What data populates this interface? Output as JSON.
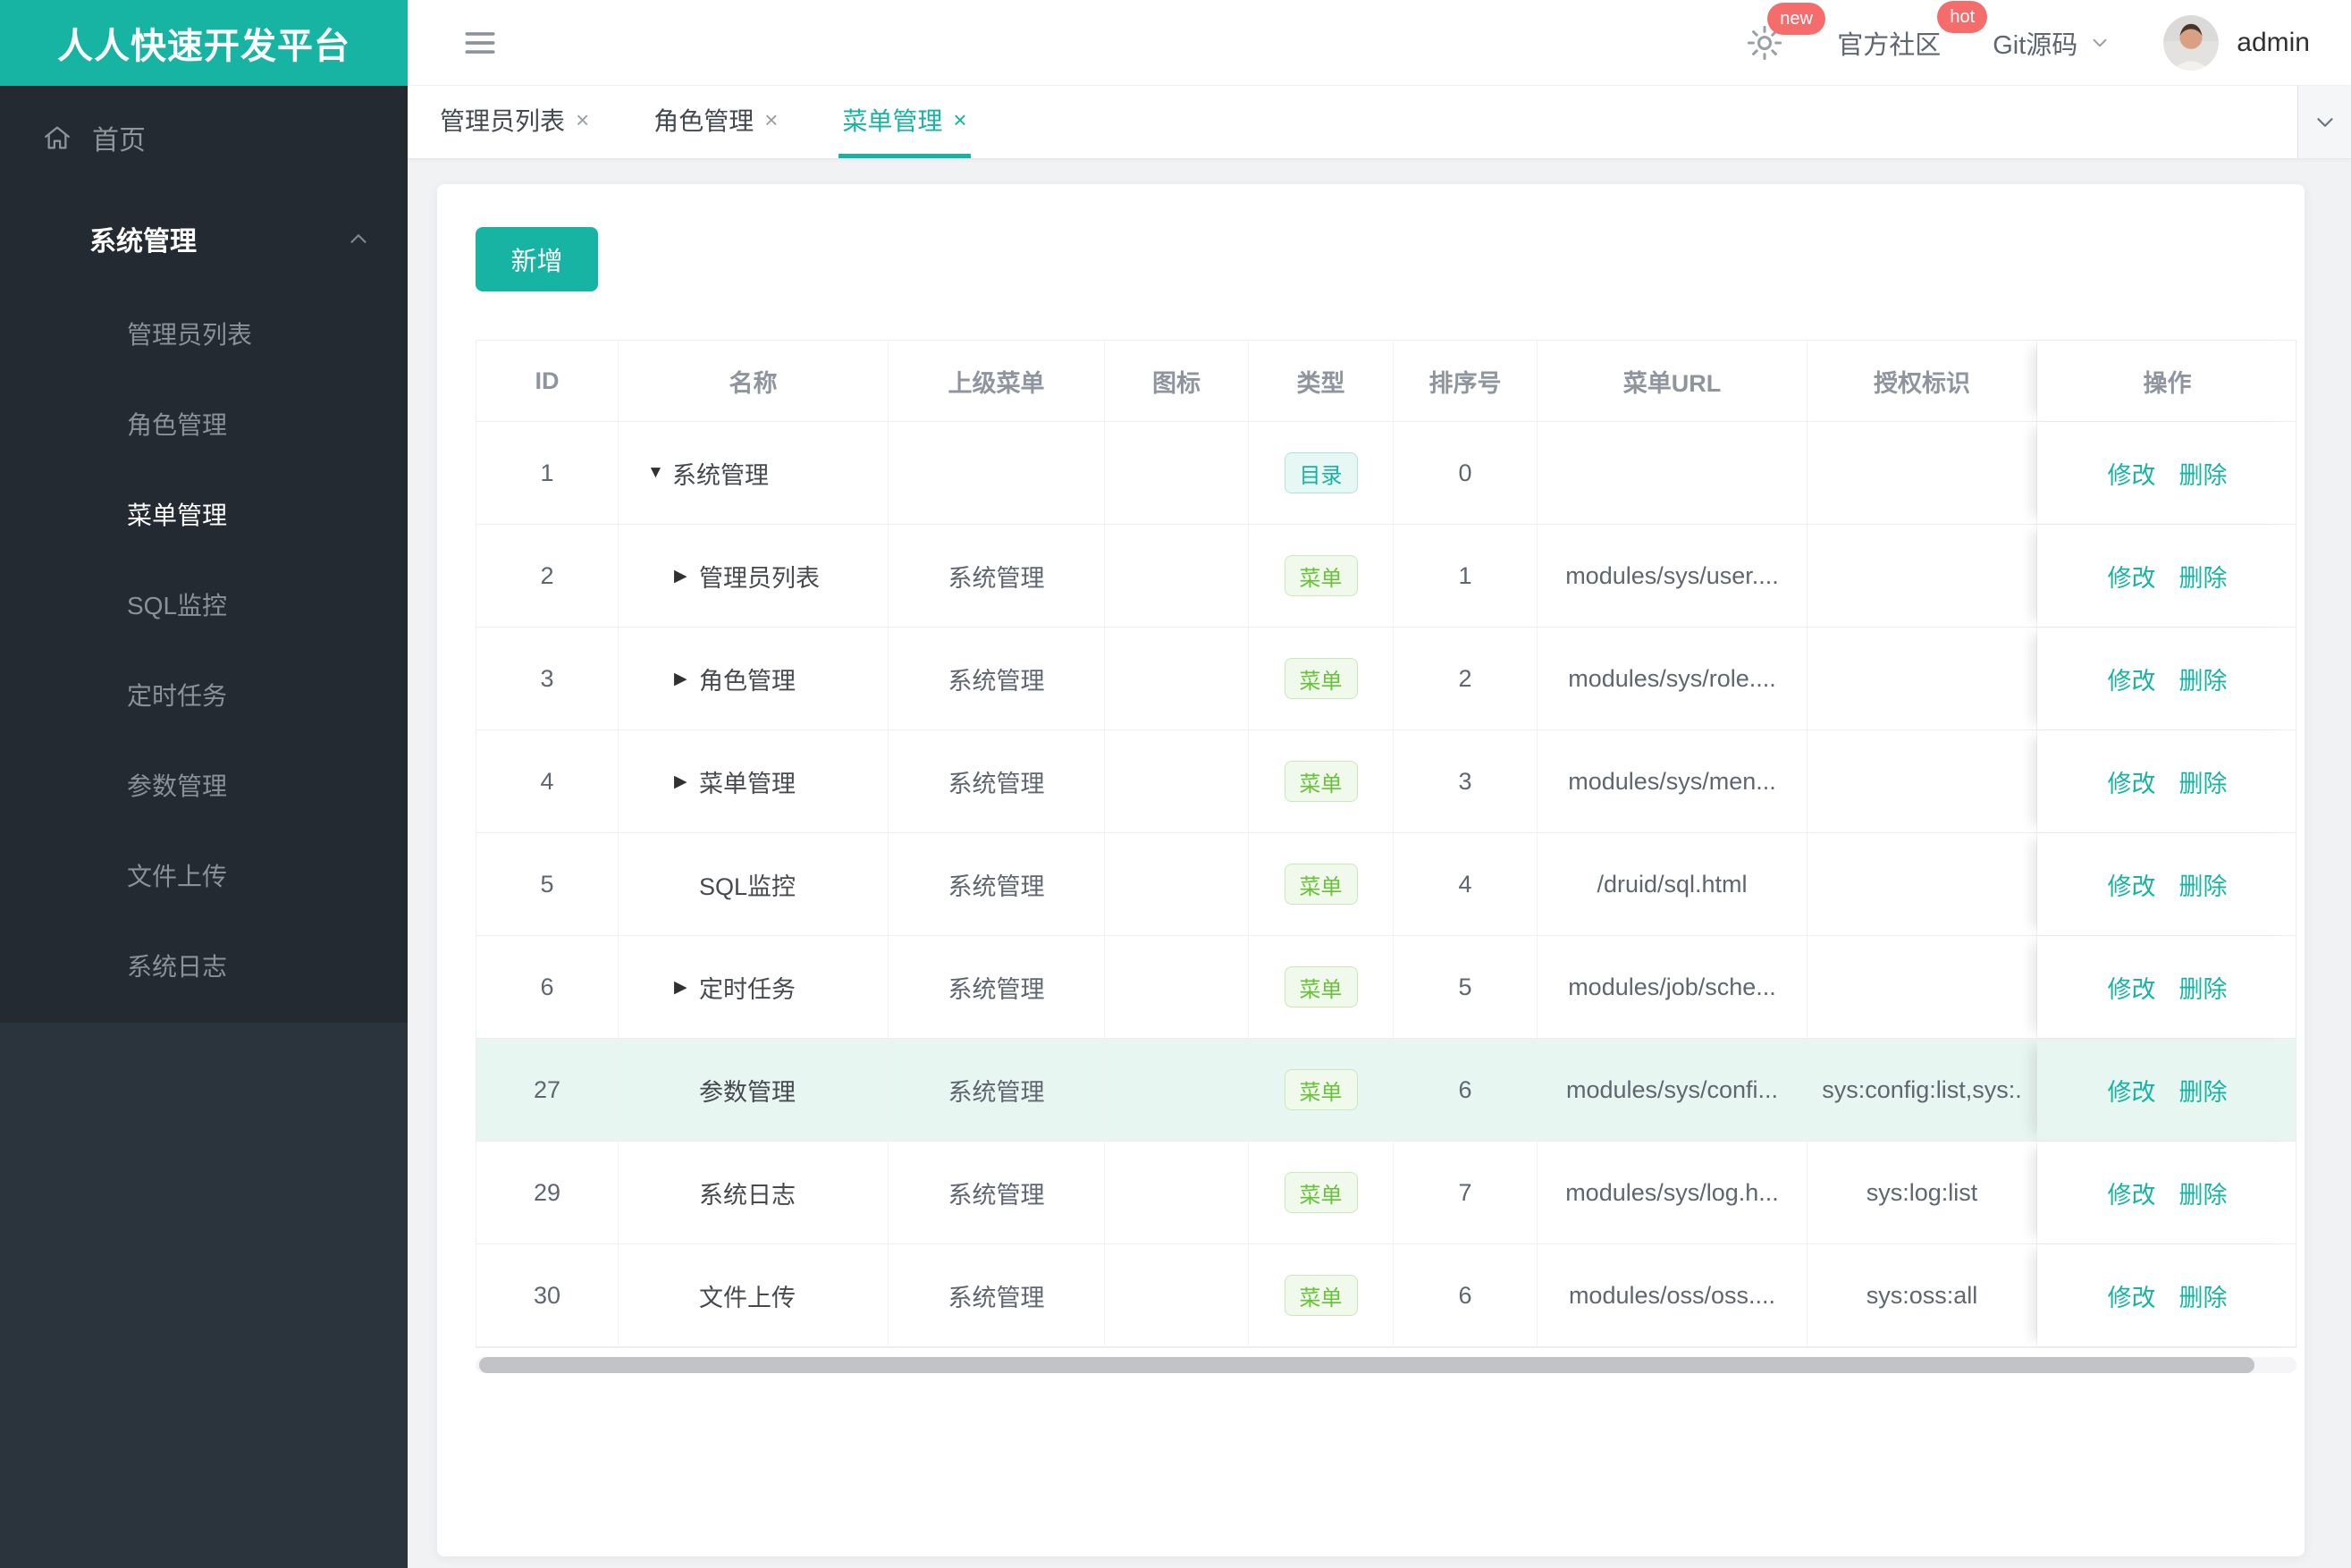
{
  "brand": {
    "title": "人人快速开发平台",
    "accent_color": "#17b3a3",
    "danger_color": "#f56c6c"
  },
  "sidebar": {
    "home": {
      "label": "首页"
    },
    "group": {
      "label": "系统管理"
    },
    "items": [
      {
        "label": "管理员列表",
        "active": false
      },
      {
        "label": "角色管理",
        "active": false
      },
      {
        "label": "菜单管理",
        "active": true
      },
      {
        "label": "SQL监控",
        "active": false
      },
      {
        "label": "定时任务",
        "active": false
      },
      {
        "label": "参数管理",
        "active": false
      },
      {
        "label": "文件上传",
        "active": false
      },
      {
        "label": "系统日志",
        "active": false
      }
    ]
  },
  "topbar": {
    "new_badge": "new",
    "hot_badge": "hot",
    "community_label": "官方社区",
    "git_label": "Git源码",
    "username": "admin"
  },
  "tabs": [
    {
      "label": "管理员列表",
      "close": "×",
      "active": false
    },
    {
      "label": "角色管理",
      "close": "×",
      "active": false
    },
    {
      "label": "菜单管理",
      "close": "×",
      "active": true
    }
  ],
  "toolbar": {
    "add_label": "新增"
  },
  "table": {
    "headers": [
      "ID",
      "名称",
      "上级菜单",
      "图标",
      "类型",
      "排序号",
      "菜单URL",
      "授权标识",
      "操作"
    ],
    "type_labels": {
      "dir": "目录",
      "menu": "菜单"
    },
    "actions": {
      "edit": "修改",
      "delete": "删除"
    },
    "highlight_color": "#e8f6f2",
    "rows": [
      {
        "id": "1",
        "arrow": "down",
        "indent": 1,
        "name": "系统管理",
        "parent": "",
        "icon": "",
        "type": "dir",
        "order": "0",
        "url": "",
        "perms": "",
        "highlight": false
      },
      {
        "id": "2",
        "arrow": "right",
        "indent": 2,
        "name": "管理员列表",
        "parent": "系统管理",
        "icon": "",
        "type": "menu",
        "order": "1",
        "url": "modules/sys/user....",
        "perms": "",
        "highlight": false
      },
      {
        "id": "3",
        "arrow": "right",
        "indent": 2,
        "name": "角色管理",
        "parent": "系统管理",
        "icon": "",
        "type": "menu",
        "order": "2",
        "url": "modules/sys/role....",
        "perms": "",
        "highlight": false
      },
      {
        "id": "4",
        "arrow": "right",
        "indent": 2,
        "name": "菜单管理",
        "parent": "系统管理",
        "icon": "",
        "type": "menu",
        "order": "3",
        "url": "modules/sys/men...",
        "perms": "",
        "highlight": false
      },
      {
        "id": "5",
        "arrow": "none",
        "indent": 2,
        "name": "SQL监控",
        "parent": "系统管理",
        "icon": "",
        "type": "menu",
        "order": "4",
        "url": "/druid/sql.html",
        "perms": "",
        "highlight": false
      },
      {
        "id": "6",
        "arrow": "right",
        "indent": 2,
        "name": "定时任务",
        "parent": "系统管理",
        "icon": "",
        "type": "menu",
        "order": "5",
        "url": "modules/job/sche...",
        "perms": "",
        "highlight": false
      },
      {
        "id": "27",
        "arrow": "none",
        "indent": 2,
        "name": "参数管理",
        "parent": "系统管理",
        "icon": "",
        "type": "menu",
        "order": "6",
        "url": "modules/sys/confi...",
        "perms": "sys:config:list,sys:.",
        "highlight": true
      },
      {
        "id": "29",
        "arrow": "none",
        "indent": 2,
        "name": "系统日志",
        "parent": "系统管理",
        "icon": "",
        "type": "menu",
        "order": "7",
        "url": "modules/sys/log.h...",
        "perms": "sys:log:list",
        "highlight": false
      },
      {
        "id": "30",
        "arrow": "none",
        "indent": 2,
        "name": "文件上传",
        "parent": "系统管理",
        "icon": "",
        "type": "menu",
        "order": "6",
        "url": "modules/oss/oss....",
        "perms": "sys:oss:all",
        "highlight": false
      }
    ]
  }
}
